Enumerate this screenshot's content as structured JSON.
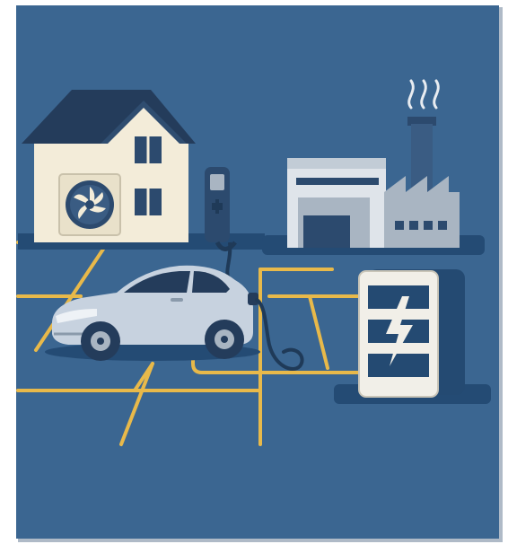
{
  "scene": {
    "description_items": [],
    "colors": {
      "panel_bg": "#3b6691",
      "panel_shadow": "#1b3a5e",
      "grid_lines": "#e8b94a",
      "ground_shadow": "#244b74",
      "house_wall": "#f3ecd9",
      "house_roof": "#243c5b",
      "heat_pump_body": "#f3ecd9",
      "heat_pump_fan": "#2c4a6e",
      "factory_light": "#dfe4ea",
      "factory_mid": "#a9b5c2",
      "factory_dark": "#2c4a6e",
      "chimney": "#3a5c83",
      "battery_body": "#f1efe8",
      "battery_dark": "#244a72",
      "car_body": "#c7d2df",
      "car_dark": "#243c5b",
      "charger": "#2c4a6e",
      "cable": "#1f3a58"
    },
    "icons": [
      "house-icon",
      "heat-pump-fan-icon",
      "ev-charger-icon",
      "factory-icon",
      "smoke-icon",
      "battery-storage-icon",
      "lightning-bolt-icon",
      "electric-car-icon",
      "charging-cable-icon",
      "power-grid-lines"
    ]
  }
}
